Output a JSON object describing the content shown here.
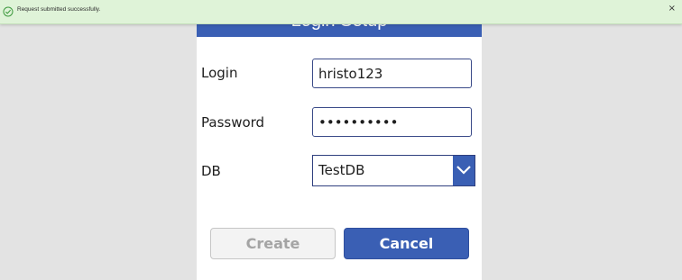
{
  "notification": {
    "message": "Request submitted successfully.",
    "close_glyph": "×",
    "icon": "check-circle-icon",
    "background": "#dff3d8"
  },
  "form": {
    "header_title": "Login Setup",
    "fields": {
      "login": {
        "label": "Login",
        "value": "hristo123"
      },
      "password": {
        "label": "Password",
        "value": "password12"
      },
      "db": {
        "label": "DB",
        "value": "TestDB"
      }
    },
    "buttons": {
      "create": "Create",
      "cancel": "Cancel"
    }
  },
  "colors": {
    "accent": "#3a5fb4",
    "input_border": "#3a4a88",
    "disabled_text": "#a4a4a4",
    "page_background": "#e3e3e3"
  }
}
